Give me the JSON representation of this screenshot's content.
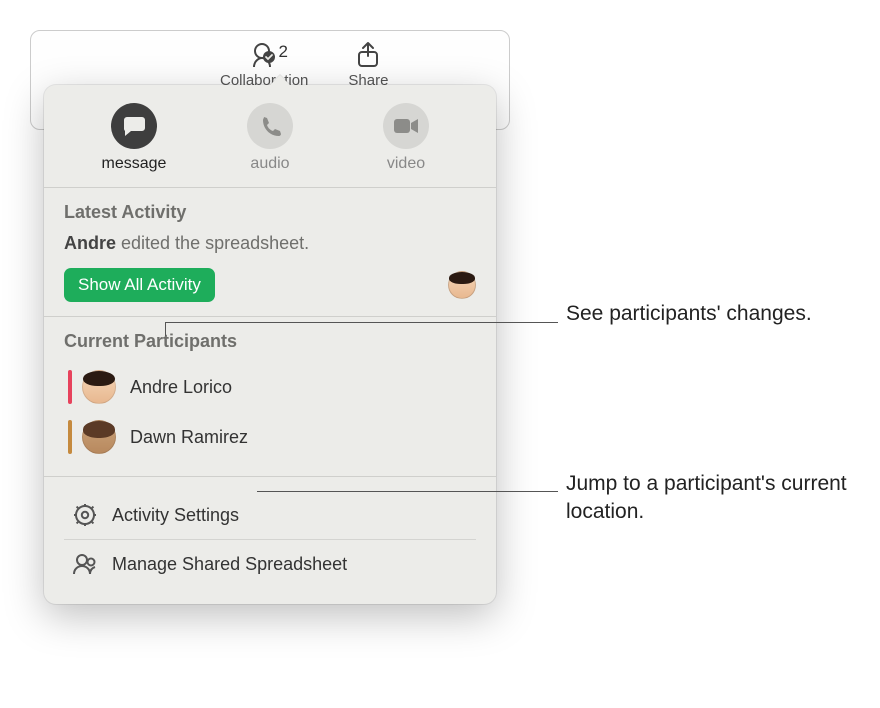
{
  "toolbar": {
    "collaboration": {
      "label": "Collaboration",
      "count": "2"
    },
    "share": {
      "label": "Share"
    }
  },
  "popover": {
    "comm": {
      "message": "message",
      "audio": "audio",
      "video": "video"
    },
    "latest": {
      "title": "Latest Activity",
      "actor": "Andre",
      "action": " edited the spreadsheet.",
      "showAll": "Show All Activity"
    },
    "participantsTitle": "Current Participants",
    "participants": [
      {
        "name": "Andre Lorico",
        "color": "#e7425c",
        "hair": "dark",
        "skin": "light"
      },
      {
        "name": "Dawn Ramirez",
        "color": "#c58a3e",
        "hair": "brown",
        "skin": "mid"
      }
    ],
    "settings": {
      "activity": "Activity Settings",
      "manage": "Manage Shared Spreadsheet"
    }
  },
  "callouts": {
    "changes": "See participants' changes.",
    "jump": "Jump to a participant's current location."
  }
}
